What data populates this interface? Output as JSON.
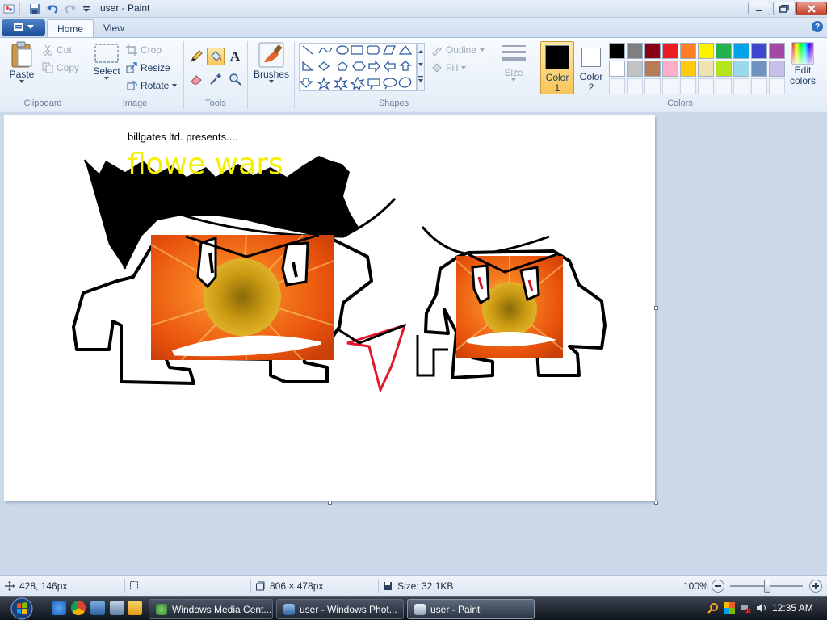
{
  "window": {
    "title": "user - Paint"
  },
  "tabs": {
    "home": "Home",
    "view": "View",
    "help": "?"
  },
  "clipboard": {
    "paste": "Paste",
    "cut": "Cut",
    "copy": "Copy",
    "label": "Clipboard"
  },
  "image": {
    "select": "Select",
    "crop": "Crop",
    "resize": "Resize",
    "rotate": "Rotate",
    "label": "Image"
  },
  "tools": {
    "label": "Tools",
    "text_glyph": "A",
    "active_tool": "fill"
  },
  "brushes": {
    "label": "Brushes"
  },
  "shapes": {
    "label": "Shapes",
    "outline": "Outline",
    "fill": "Fill"
  },
  "size": {
    "label": "Size"
  },
  "colors": {
    "color1_label": "Color",
    "color1_num": "1",
    "color2_label": "Color",
    "color2_num": "2",
    "edit_label": "Edit colors",
    "label": "Colors",
    "color1_value": "#000000",
    "color2_value": "#ffffff",
    "palette_row1": [
      "#000000",
      "#7f7f7f",
      "#880015",
      "#ed1c24",
      "#ff7f27",
      "#fff200",
      "#22b14c",
      "#00a2e8",
      "#3f48cc",
      "#a349a4"
    ],
    "palette_row2": [
      "#ffffff",
      "#c3c3c3",
      "#b97a57",
      "#ffaec9",
      "#ffc90e",
      "#efe4b0",
      "#b5e61d",
      "#99d9ea",
      "#7092be",
      "#c8bfe7"
    ]
  },
  "drawing": {
    "caption": "billgates ltd. presents....",
    "headline": "flowe wars",
    "headline_color": "#f5f000",
    "flower_color": "#f36a10",
    "center_color": "#c99a12"
  },
  "status": {
    "cursor_pos": "428, 146px",
    "selection_size": "",
    "canvas_size": "806 × 478px",
    "file_size": "Size: 32.1KB",
    "zoom": "100%"
  },
  "taskbar": {
    "items": [
      {
        "label": "Windows Media Cent...",
        "active": false
      },
      {
        "label": "user - Windows Phot...",
        "active": false
      },
      {
        "label": "user - Paint",
        "active": true
      }
    ],
    "clock": "12:35 AM"
  }
}
